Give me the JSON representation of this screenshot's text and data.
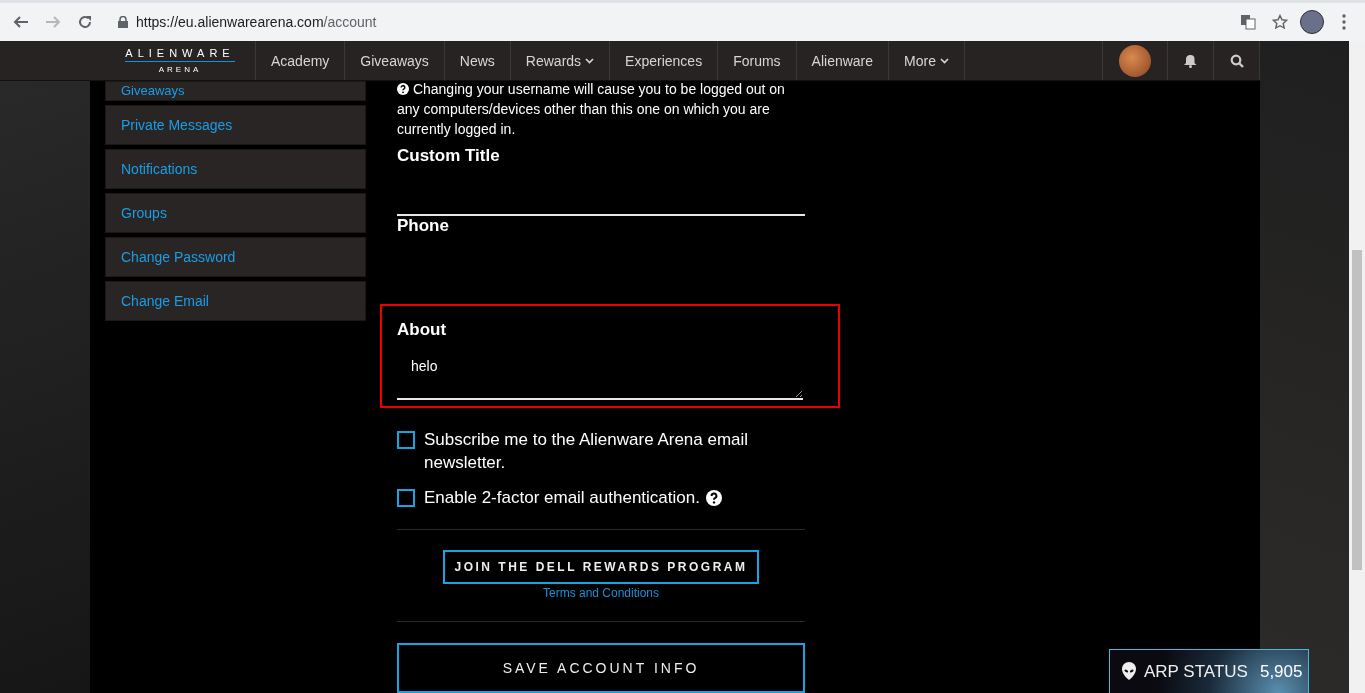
{
  "browser": {
    "url_host": "https://eu.alienwarearena.com",
    "url_path": "/account",
    "forward_disabled": true
  },
  "nav": {
    "logo_top": "ALIENWARE",
    "logo_bottom": "ARENA",
    "items": [
      {
        "label": "Academy",
        "dropdown": false
      },
      {
        "label": "Giveaways",
        "dropdown": false
      },
      {
        "label": "News",
        "dropdown": false
      },
      {
        "label": "Rewards",
        "dropdown": true
      },
      {
        "label": "Experiences",
        "dropdown": false
      },
      {
        "label": "Forums",
        "dropdown": false
      },
      {
        "label": "Alienware",
        "dropdown": false
      },
      {
        "label": "More",
        "dropdown": true
      }
    ]
  },
  "sidebar": {
    "items": [
      {
        "label": "Giveaways",
        "clipped": true
      },
      {
        "label": "Private Messages",
        "clipped": false
      },
      {
        "label": "Notifications",
        "clipped": false
      },
      {
        "label": "Groups",
        "clipped": false
      },
      {
        "label": "Change Password",
        "clipped": false
      },
      {
        "label": "Change Email",
        "clipped": false
      }
    ]
  },
  "form": {
    "notice": "Changing your username will cause you to be logged out on any computers/devices other than this one on which you are currently logged in.",
    "fields": [
      {
        "kind": "input",
        "label": "Custom Title",
        "highlighted": false
      },
      {
        "kind": "label",
        "label": "Phone",
        "highlighted": false
      },
      {
        "kind": "textarea",
        "label": "About",
        "value": "helo",
        "highlighted": true
      }
    ],
    "checkboxes": [
      {
        "label": "Subscribe me to the Alienware Arena email newsletter.",
        "checked": false,
        "help": false
      },
      {
        "label": "Enable 2-factor email authentication.",
        "checked": false,
        "help": true
      }
    ],
    "rewards_button": "JOIN THE DELL REWARDS PROGRAM",
    "terms_link": "Terms and Conditions",
    "save_button": "SAVE ACCOUNT INFO"
  },
  "arp_status": {
    "label": "ARP STATUS",
    "value": "5,905"
  }
}
